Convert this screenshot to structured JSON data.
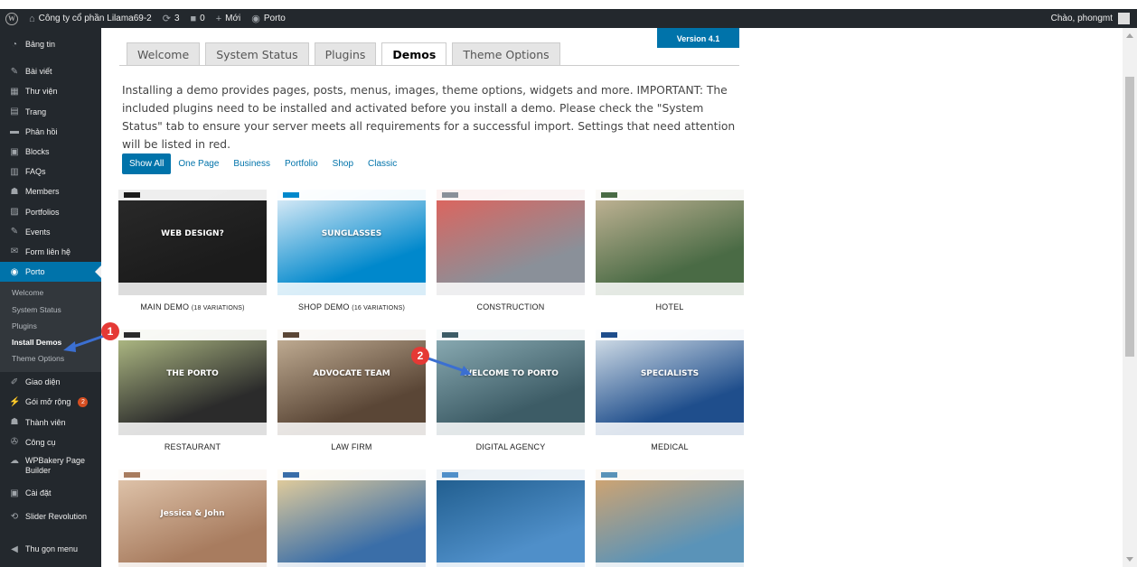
{
  "adminbar": {
    "site_name": "Công ty cổ phần Lilama69-2",
    "updates_count": "3",
    "comments_count": "0",
    "new_label": "Mới",
    "porto_label": "Porto",
    "greeting": "Chào, phongmt"
  },
  "sidebar": {
    "items": [
      {
        "label": "Bảng tin",
        "icon": "dashboard-icon"
      },
      {
        "label": "Bài viết",
        "icon": "pin-icon"
      },
      {
        "label": "Thư viện",
        "icon": "media-icon"
      },
      {
        "label": "Trang",
        "icon": "page-icon"
      },
      {
        "label": "Phản hồi",
        "icon": "comment-icon"
      },
      {
        "label": "Blocks",
        "icon": "blocks-icon"
      },
      {
        "label": "FAQs",
        "icon": "faq-icon"
      },
      {
        "label": "Members",
        "icon": "members-icon"
      },
      {
        "label": "Portfolios",
        "icon": "portfolio-icon"
      },
      {
        "label": "Events",
        "icon": "pin-icon"
      },
      {
        "label": "Form liên hệ",
        "icon": "mail-icon"
      },
      {
        "label": "Porto",
        "icon": "porto-icon"
      }
    ],
    "submenu": [
      "Welcome",
      "System Status",
      "Plugins",
      "Install Demos",
      "Theme Options"
    ],
    "items_after": [
      {
        "label": "Giao diện",
        "icon": "brush-icon"
      },
      {
        "label": "Gói mở rộng",
        "icon": "plugin-icon",
        "badge": "2"
      },
      {
        "label": "Thành viên",
        "icon": "user-icon"
      },
      {
        "label": "Công cụ",
        "icon": "wrench-icon"
      },
      {
        "label": "WPBakery Page Builder",
        "icon": "wpbakery-icon"
      },
      {
        "label": "Cài đặt",
        "icon": "settings-icon"
      },
      {
        "label": "Slider Revolution",
        "icon": "refresh-icon"
      },
      {
        "label": "Thu gọn menu",
        "icon": "collapse-icon"
      }
    ]
  },
  "version_label": "Version 4.1",
  "tabs": [
    "Welcome",
    "System Status",
    "Plugins",
    "Demos",
    "Theme Options"
  ],
  "intro_text": "Installing a demo provides pages, posts, menus, images, theme options, widgets and more. IMPORTANT: The included plugins need to be installed and activated before you install a demo. Please check the \"System Status\" tab to ensure your server meets all requirements for a successful import. Settings that need attention will be listed in red.",
  "filters": [
    "Show All",
    "One Page",
    "Business",
    "Portfolio",
    "Shop",
    "Classic"
  ],
  "demos": [
    {
      "name": "MAIN DEMO",
      "variations": "(18 VARIATIONS)",
      "thumb_text": "WEB DESIGN?",
      "palette": [
        "#1b1b1b",
        "#2a2a2a"
      ]
    },
    {
      "name": "SHOP DEMO",
      "variations": "(16 VARIATIONS)",
      "thumb_text": "SUNGLASSES",
      "palette": [
        "#0088cc",
        "#e9f2fa"
      ]
    },
    {
      "name": "CONSTRUCTION",
      "variations": "",
      "thumb_text": "",
      "palette": [
        "#8a9099",
        "#e36159"
      ]
    },
    {
      "name": "HOTEL",
      "variations": "",
      "thumb_text": "",
      "palette": [
        "#4a6b45",
        "#c9b89a"
      ]
    },
    {
      "name": "RESTAURANT",
      "variations": "",
      "thumb_text": "THE PORTO",
      "palette": [
        "#2b2b2b",
        "#b8c48a"
      ]
    },
    {
      "name": "LAW FIRM",
      "variations": "",
      "thumb_text": "ADVOCATE TEAM",
      "palette": [
        "#5a4636",
        "#c8b49a"
      ]
    },
    {
      "name": "DIGITAL AGENCY",
      "variations": "",
      "thumb_text": "WELCOME TO PORTO",
      "palette": [
        "#3d5c66",
        "#8fb0b8"
      ]
    },
    {
      "name": "MEDICAL",
      "variations": "",
      "thumb_text": "SPECIALISTS",
      "palette": [
        "#1f4e8c",
        "#dfe8ee"
      ]
    },
    {
      "name": "",
      "variations": "",
      "thumb_text": "Jessica & John",
      "palette": [
        "#a87c5f",
        "#e3c9b0"
      ]
    },
    {
      "name": "",
      "variations": "",
      "thumb_text": "",
      "palette": [
        "#3a6ea8",
        "#f0d49a"
      ]
    },
    {
      "name": "",
      "variations": "",
      "thumb_text": "",
      "palette": [
        "#4f8fc9",
        "#1d5a8a"
      ]
    },
    {
      "name": "",
      "variations": "",
      "thumb_text": "",
      "palette": [
        "#5a93b8",
        "#d9a56b"
      ]
    }
  ],
  "callouts": [
    "1",
    "2"
  ],
  "colors": {
    "accent": "#0073aa",
    "sidebar": "#23282d",
    "callout": "#e53935",
    "arrow": "#3b6fd1"
  }
}
